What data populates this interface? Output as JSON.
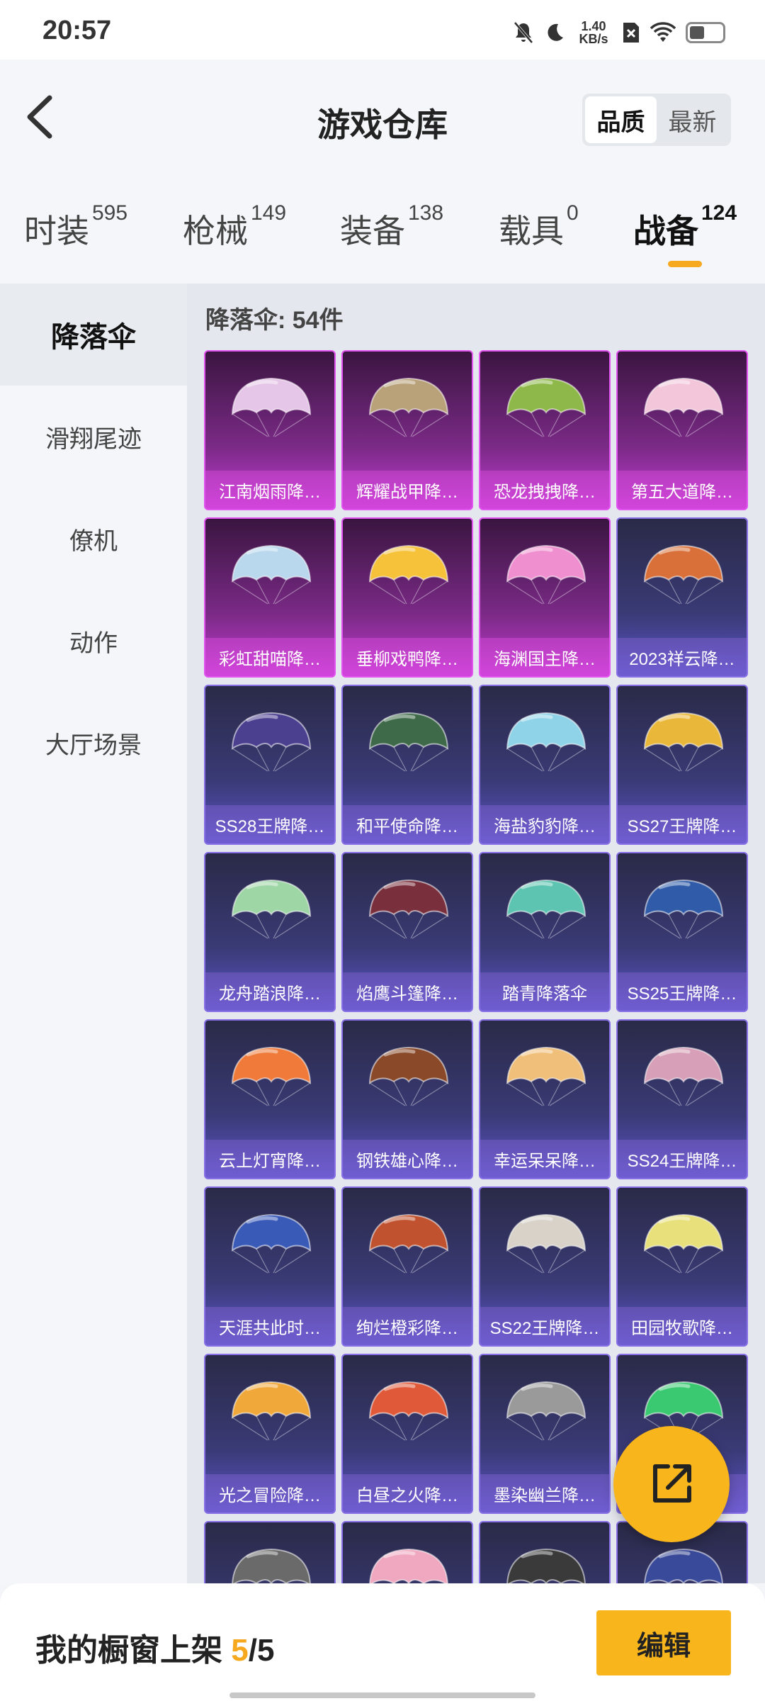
{
  "status_bar": {
    "time": "20:57",
    "net_speed_value": "1.40",
    "net_speed_unit": "KB/s",
    "battery_level": 0.45
  },
  "header": {
    "title": "游戏仓库",
    "sort_options": [
      "品质",
      "最新"
    ],
    "selected_sort": "品质"
  },
  "tabs": [
    {
      "label": "时装",
      "count": "595"
    },
    {
      "label": "枪械",
      "count": "149"
    },
    {
      "label": "装备",
      "count": "138"
    },
    {
      "label": "载具",
      "count": "0"
    },
    {
      "label": "战备",
      "count": "124",
      "active": true
    }
  ],
  "sidebar": {
    "items": [
      "降落伞",
      "滑翔尾迹",
      "僚机",
      "动作",
      "大厅场景"
    ],
    "active": "降落伞"
  },
  "content": {
    "count_label": "降落伞: 54件",
    "items": [
      {
        "name": "江南烟雨降…",
        "tier": "purple",
        "color": "#e6c6e8"
      },
      {
        "name": "辉耀战甲降…",
        "tier": "purple",
        "color": "#b9a27a"
      },
      {
        "name": "恐龙拽拽降…",
        "tier": "purple",
        "color": "#8fb84a"
      },
      {
        "name": "第五大道降…",
        "tier": "purple",
        "color": "#f3c6da"
      },
      {
        "name": "彩虹甜喵降…",
        "tier": "purple",
        "color": "#b9d8ee"
      },
      {
        "name": "垂柳戏鸭降…",
        "tier": "purple",
        "color": "#f6c23a"
      },
      {
        "name": "海渊国主降…",
        "tier": "purple",
        "color": "#f08fcf"
      },
      {
        "name": "2023祥云降…",
        "tier": "blue",
        "color": "#d9703a"
      },
      {
        "name": "SS28王牌降…",
        "tier": "blue",
        "color": "#4b3f8f"
      },
      {
        "name": "和平使命降…",
        "tier": "blue",
        "color": "#3f6a4a"
      },
      {
        "name": "海盐豹豹降…",
        "tier": "blue",
        "color": "#8fd3e8"
      },
      {
        "name": "SS27王牌降…",
        "tier": "blue",
        "color": "#e9b73a"
      },
      {
        "name": "龙舟踏浪降…",
        "tier": "blue",
        "color": "#9ed6a6"
      },
      {
        "name": "焰鹰斗篷降…",
        "tier": "blue",
        "color": "#7a2f3c"
      },
      {
        "name": "踏青降落伞",
        "tier": "blue",
        "color": "#5cc4b0"
      },
      {
        "name": "SS25王牌降…",
        "tier": "blue",
        "color": "#2f5ba8"
      },
      {
        "name": "云上灯宵降…",
        "tier": "blue",
        "color": "#f07a3a"
      },
      {
        "name": "钢铁雄心降…",
        "tier": "blue",
        "color": "#8a4a2a"
      },
      {
        "name": "幸运呆呆降…",
        "tier": "blue",
        "color": "#f0c07a"
      },
      {
        "name": "SS24王牌降…",
        "tier": "blue",
        "color": "#d8a0b8"
      },
      {
        "name": "天涯共此时…",
        "tier": "blue",
        "color": "#3a5ab8"
      },
      {
        "name": "绚烂橙彩降…",
        "tier": "blue",
        "color": "#c0522f"
      },
      {
        "name": "SS22王牌降…",
        "tier": "blue",
        "color": "#d8d2c8"
      },
      {
        "name": "田园牧歌降…",
        "tier": "blue",
        "color": "#e8e07a"
      },
      {
        "name": "光之冒险降…",
        "tier": "blue",
        "color": "#f0a83a"
      },
      {
        "name": "白昼之火降…",
        "tier": "blue",
        "color": "#e05a3a"
      },
      {
        "name": "墨染幽兰降…",
        "tier": "blue",
        "color": "#9a9a9a"
      },
      {
        "name": "",
        "tier": "blue",
        "color": "#3ac870"
      },
      {
        "name": "",
        "tier": "blue",
        "color": "#6a6a6a"
      },
      {
        "name": "",
        "tier": "blue",
        "color": "#f0a8c0"
      },
      {
        "name": "",
        "tier": "blue",
        "color": "#3a3a3a"
      },
      {
        "name": "",
        "tier": "blue",
        "color": "#3a4a9a"
      }
    ]
  },
  "bottom_bar": {
    "label": "我的橱窗上架",
    "current": "5",
    "separator": "/",
    "total": "5",
    "edit_label": "编辑"
  },
  "colors": {
    "accent": "#f6a81e",
    "fab": "#f8b51c"
  }
}
